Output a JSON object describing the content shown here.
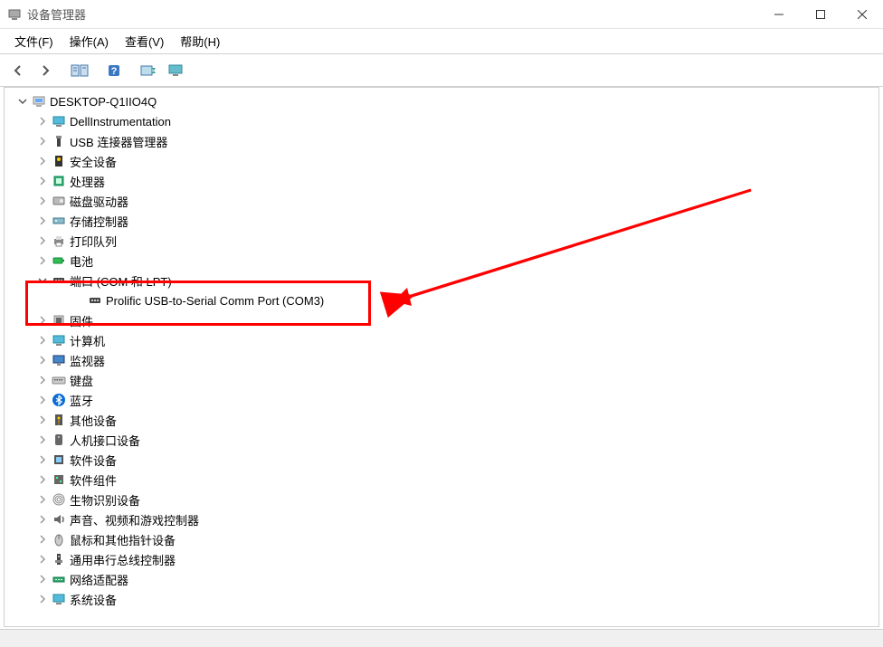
{
  "window": {
    "title": "设备管理器",
    "controls": {
      "min": "—",
      "max": "□",
      "close": "✕"
    }
  },
  "menubar": {
    "file": "文件(F)",
    "action": "操作(A)",
    "view": "查看(V)",
    "help": "帮助(H)"
  },
  "toolbar": {
    "back": "back",
    "forward": "forward",
    "show_hidden": "show-hidden",
    "help": "help",
    "scan": "scan",
    "monitor": "monitor"
  },
  "tree": {
    "root": "DESKTOP-Q1IIO4Q",
    "nodes": [
      {
        "label": "DellInstrumentation",
        "icon": "monitor",
        "expanded": false
      },
      {
        "label": "USB 连接器管理器",
        "icon": "usb",
        "expanded": false
      },
      {
        "label": "安全设备",
        "icon": "security",
        "expanded": false
      },
      {
        "label": "处理器",
        "icon": "cpu",
        "expanded": false
      },
      {
        "label": "磁盘驱动器",
        "icon": "disk",
        "expanded": false
      },
      {
        "label": "存储控制器",
        "icon": "storage",
        "expanded": false
      },
      {
        "label": "打印队列",
        "icon": "printer",
        "expanded": false
      },
      {
        "label": "电池",
        "icon": "battery",
        "expanded": false
      },
      {
        "label": "端口 (COM 和 LPT)",
        "icon": "port",
        "expanded": true,
        "children": [
          {
            "label": "Prolific USB-to-Serial Comm Port (COM3)",
            "icon": "port"
          }
        ]
      },
      {
        "label": "固件",
        "icon": "firmware",
        "expanded": false
      },
      {
        "label": "计算机",
        "icon": "computer",
        "expanded": false
      },
      {
        "label": "监视器",
        "icon": "display",
        "expanded": false
      },
      {
        "label": "键盘",
        "icon": "keyboard",
        "expanded": false
      },
      {
        "label": "蓝牙",
        "icon": "bluetooth",
        "expanded": false
      },
      {
        "label": "其他设备",
        "icon": "other",
        "expanded": false
      },
      {
        "label": "人机接口设备",
        "icon": "hid",
        "expanded": false
      },
      {
        "label": "软件设备",
        "icon": "software",
        "expanded": false
      },
      {
        "label": "软件组件",
        "icon": "component",
        "expanded": false
      },
      {
        "label": "生物识别设备",
        "icon": "biometric",
        "expanded": false
      },
      {
        "label": "声音、视频和游戏控制器",
        "icon": "sound",
        "expanded": false
      },
      {
        "label": "鼠标和其他指针设备",
        "icon": "mouse",
        "expanded": false
      },
      {
        "label": "通用串行总线控制器",
        "icon": "usbctrl",
        "expanded": false
      },
      {
        "label": "网络适配器",
        "icon": "network",
        "expanded": false
      },
      {
        "label": "系统设备",
        "icon": "system",
        "expanded": false
      }
    ]
  },
  "annotation": {
    "highlighted_item": "端口 (COM 和 LPT) > Prolific USB-to-Serial Comm Port (COM3)"
  }
}
